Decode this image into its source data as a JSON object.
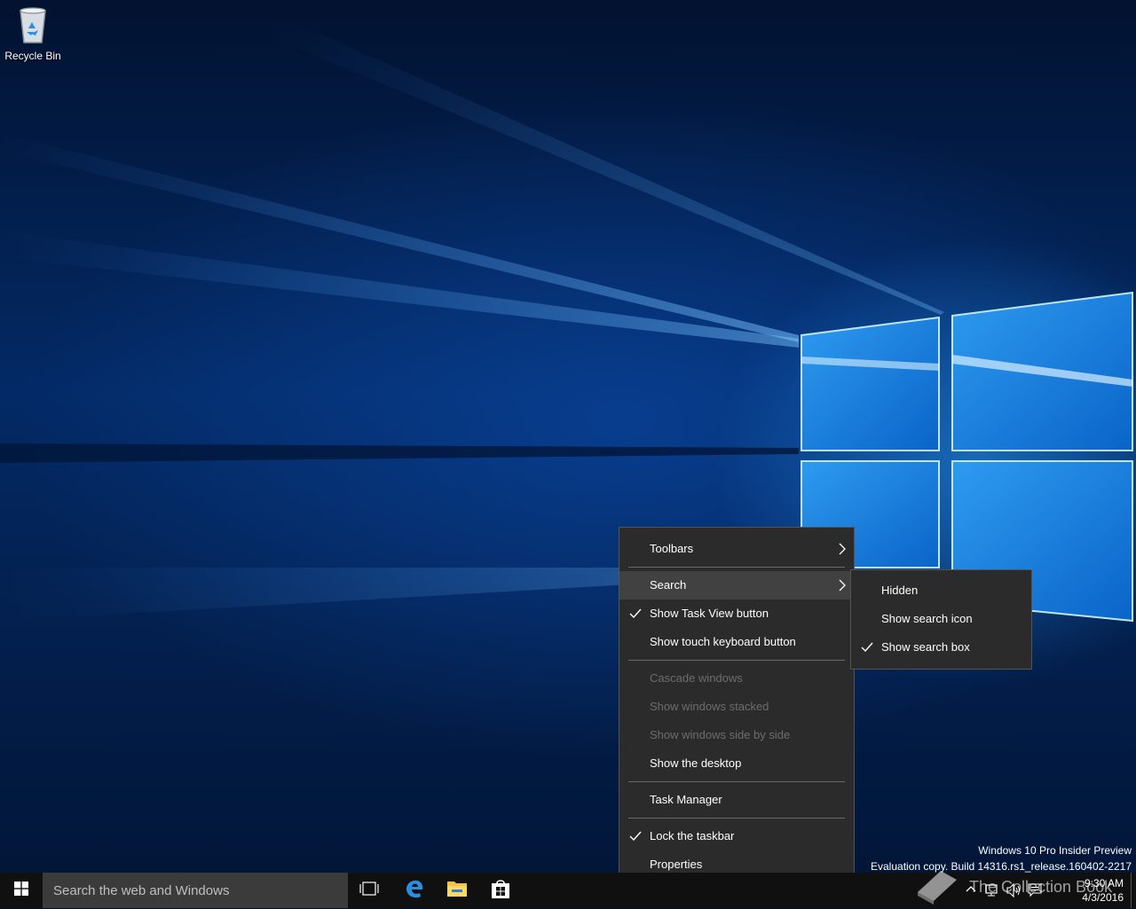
{
  "desktop": {
    "icons": [
      {
        "label": "Recycle Bin",
        "icon": "recycle-bin-icon"
      }
    ],
    "watermark": {
      "line1": "Windows 10 Pro Insider Preview",
      "line2": "Evaluation copy. Build 14316.rs1_release.160402-2217"
    }
  },
  "context_menu": {
    "items": [
      {
        "label": "Toolbars",
        "has_submenu": true
      },
      {
        "label": "Search",
        "has_submenu": true,
        "highlighted": true
      },
      {
        "label": "Show Task View button",
        "checked": true
      },
      {
        "label": "Show touch keyboard button"
      },
      {
        "label": "Cascade windows",
        "disabled": true
      },
      {
        "label": "Show windows stacked",
        "disabled": true
      },
      {
        "label": "Show windows side by side",
        "disabled": true
      },
      {
        "label": "Show the desktop"
      },
      {
        "label": "Task Manager"
      },
      {
        "label": "Lock the taskbar",
        "checked": true
      },
      {
        "label": "Properties"
      }
    ]
  },
  "search_submenu": {
    "items": [
      {
        "label": "Hidden"
      },
      {
        "label": "Show search icon"
      },
      {
        "label": "Show search box",
        "checked": true
      }
    ]
  },
  "taskbar": {
    "search_placeholder": "Search the web and Windows",
    "pinned": [
      "task-view-icon",
      "edge-icon",
      "file-explorer-icon",
      "store-icon"
    ],
    "clock": {
      "time": "9:30 AM",
      "date": "4/3/2016"
    },
    "tray_icons": [
      "chevron-up-icon",
      "network-icon",
      "volume-icon",
      "action-center-icon"
    ],
    "brand_overlay": "The Collection Book"
  },
  "colors": {
    "menu_bg": "#2b2b2b",
    "menu_hover": "#414141",
    "taskbar_bg": "#101010",
    "search_bg": "#3b3b3b",
    "accent": "#0078d7"
  }
}
